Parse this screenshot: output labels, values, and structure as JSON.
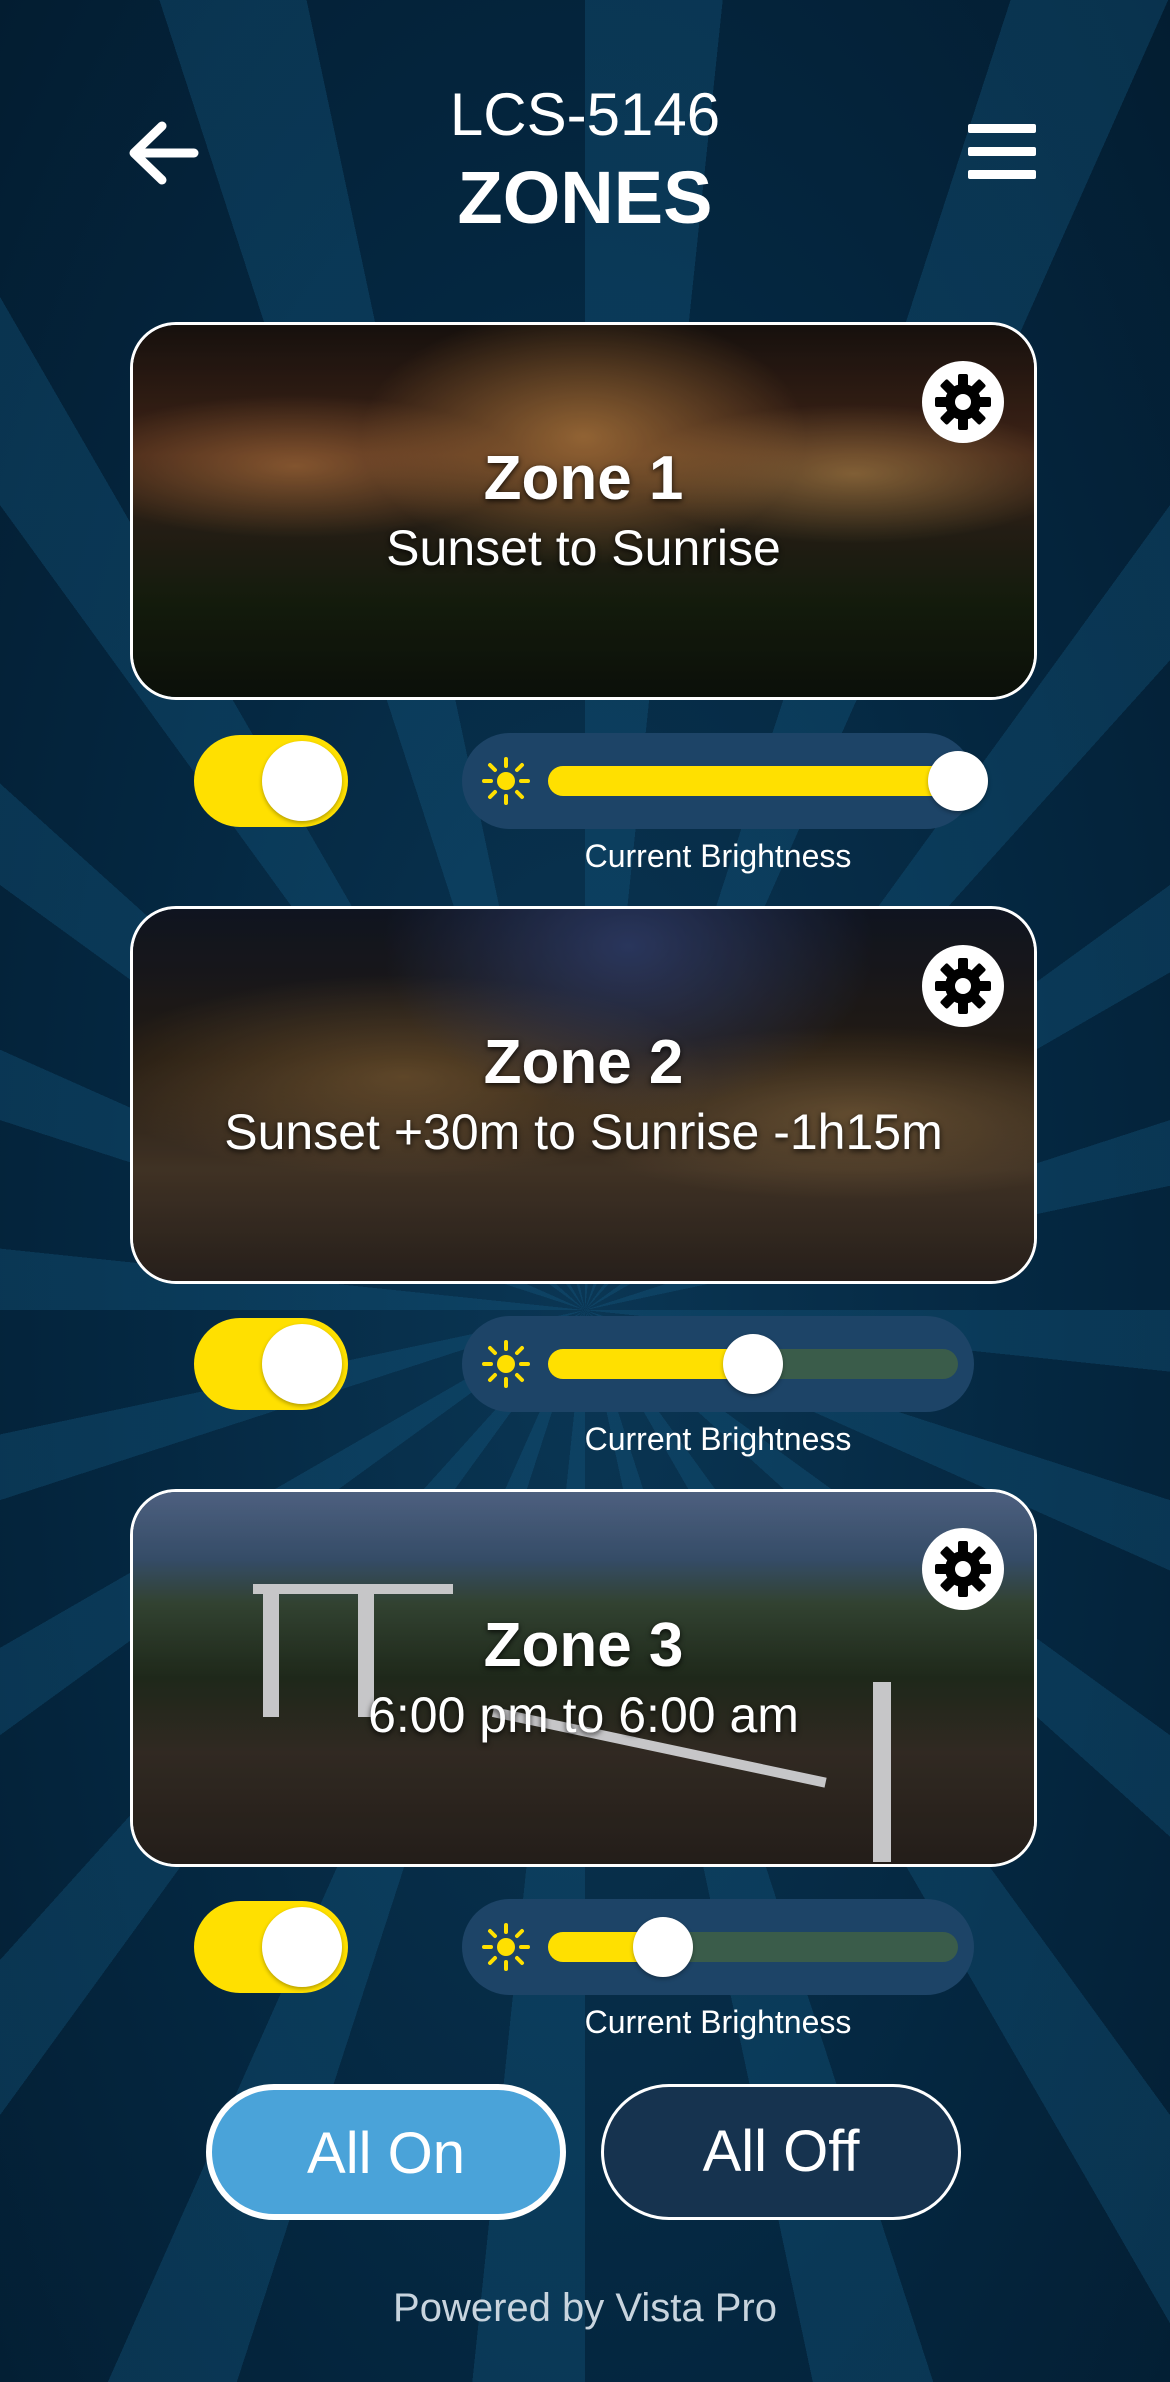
{
  "header": {
    "device_name": "LCS-5146",
    "title": "ZONES",
    "back_icon": "arrow-left-icon",
    "menu_icon": "hamburger-menu-icon"
  },
  "zones": [
    {
      "name": "Zone 1",
      "schedule": "Sunset to Sunrise",
      "enabled": true,
      "brightness_fraction": 1.0,
      "brightness_label": "Current Brightness"
    },
    {
      "name": "Zone 2",
      "schedule": "Sunset +30m to Sunrise -1h15m",
      "enabled": true,
      "brightness_fraction": 0.5,
      "brightness_label": "Current Brightness"
    },
    {
      "name": "Zone 3",
      "schedule": "6:00 pm to 6:00 am",
      "enabled": true,
      "brightness_fraction": 0.28,
      "brightness_label": "Current Brightness"
    }
  ],
  "actions": {
    "all_on": "All On",
    "all_off": "All Off"
  },
  "footer": "Powered by Vista Pro",
  "colors": {
    "background": "#04263f",
    "accent_yellow": "#ffe000",
    "all_on_blue": "#4aa3d9",
    "slider_bg": "#1d4467"
  }
}
